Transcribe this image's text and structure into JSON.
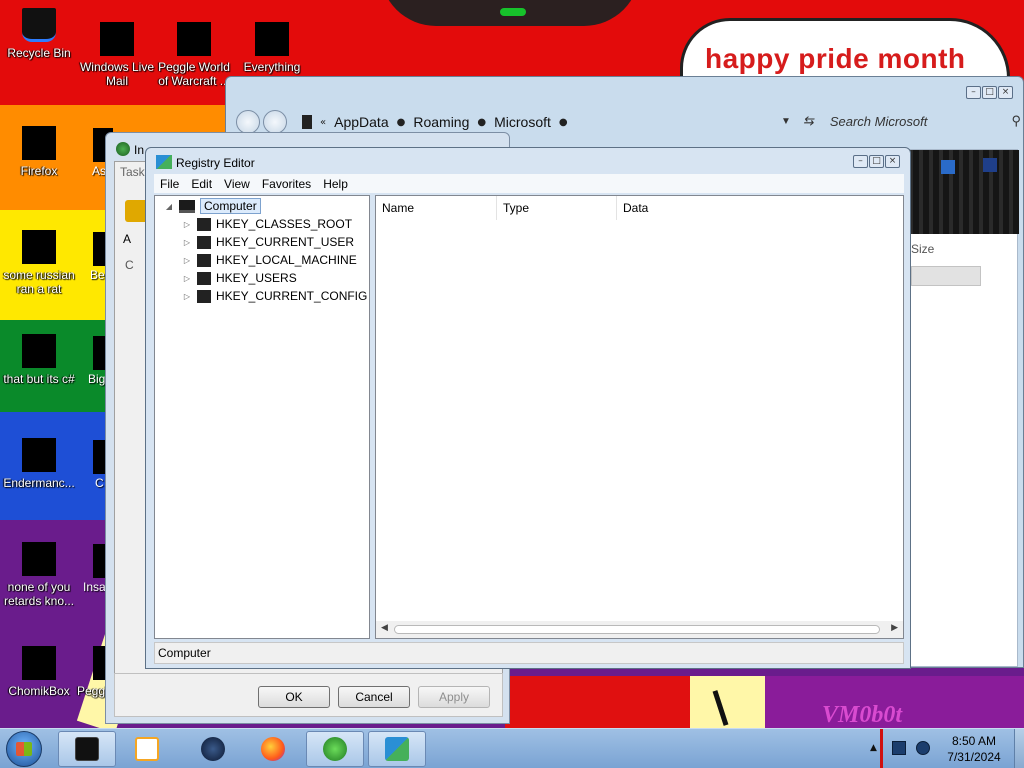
{
  "wallpaper": {
    "banner_text": "happy pride month",
    "watermark": "VM0b0t"
  },
  "desktop_icons": [
    {
      "name": "recycle-bin",
      "label": "Recycle Bin"
    },
    {
      "name": "windows-live-mail",
      "label": "Windows Live Mail"
    },
    {
      "name": "peggle-world-of-warcraft",
      "label": "Peggle World of Warcraft ..."
    },
    {
      "name": "everything",
      "label": "Everything"
    },
    {
      "name": "firefox",
      "label": "Firefox"
    },
    {
      "name": "some-russian-ran-a-rat",
      "label": "some russian ran a rat"
    },
    {
      "name": "that-but-its-c",
      "label": "that but its c#"
    },
    {
      "name": "enderman",
      "label": "Endermanc..."
    },
    {
      "name": "none-of-you",
      "label": "none of you retards kno..."
    },
    {
      "name": "chomikbox",
      "label": "ChomikBox"
    },
    {
      "name": "peggle-deluxe",
      "label": "Peggle De..."
    }
  ],
  "partial_icons": [
    {
      "label": "As D"
    },
    {
      "label": "Be D"
    },
    {
      "label": "Big D"
    },
    {
      "label": "C D"
    },
    {
      "label": "Insa Delux"
    }
  ],
  "explorer": {
    "breadcrumb": [
      "AppData",
      "Roaming",
      "Microsoft"
    ],
    "search_placeholder": "Search Microsoft",
    "size_column": "Size"
  },
  "properties_dialog": {
    "title": "In",
    "tab": "Task",
    "letter": "A",
    "letter2": "C",
    "ok_label": "OK",
    "cancel_label": "Cancel",
    "apply_label": "Apply"
  },
  "registry_editor": {
    "title": "Registry Editor",
    "menu": [
      "File",
      "Edit",
      "View",
      "Favorites",
      "Help"
    ],
    "tree_root": "Computer",
    "tree_keys": [
      "HKEY_CLASSES_ROOT",
      "HKEY_CURRENT_USER",
      "HKEY_LOCAL_MACHINE",
      "HKEY_USERS",
      "HKEY_CURRENT_CONFIG"
    ],
    "columns": [
      "Name",
      "Type",
      "Data"
    ],
    "status": "Computer"
  },
  "taskbar": {
    "items": [
      "explorer-window",
      "media-player",
      "dark-globe",
      "firefox",
      "internet-download-manager",
      "registry-editor"
    ],
    "clock_time": "8:50 AM",
    "clock_date": "7/31/2024"
  },
  "colors": {
    "pride_red": "#e30b0b",
    "pride_orange": "#ff8c00",
    "pride_yellow": "#ffe800",
    "pride_green": "#0a8a2a",
    "pride_blue": "#1e4fd6",
    "pride_purple": "#6a1c8c",
    "aero_frame": "#d7e4f2"
  }
}
